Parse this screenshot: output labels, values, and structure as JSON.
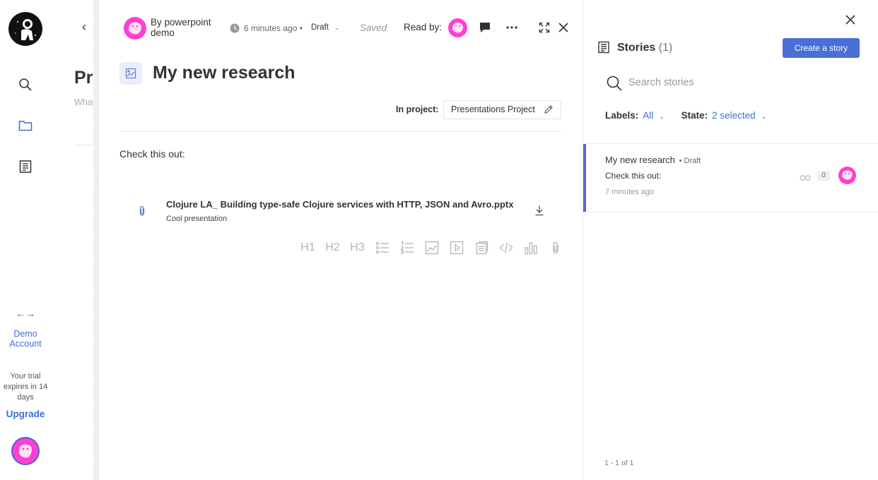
{
  "nav": {
    "items": [
      {
        "name": "search",
        "icon": "search-icon"
      },
      {
        "name": "projects",
        "icon": "folder-icon",
        "active": true
      },
      {
        "name": "stories",
        "icon": "notebook-icon"
      }
    ],
    "swap_glyph": "←→",
    "account_label": "Demo Account",
    "trial_text": "Your trial expires in 14 days",
    "upgrade_label": "Upgrade"
  },
  "background_page": {
    "back_glyph": "‹",
    "title": "Pre",
    "subtitle": "What"
  },
  "editor": {
    "author": "By powerpoint demo",
    "updated": "6 minutes ago •",
    "status": "Draft",
    "saved": "Saved",
    "read_by_label": "Read by:",
    "title": "My new research",
    "project_label": "In project:",
    "project_name": "Presentations Project",
    "body_text": "Check this out:",
    "attachment": {
      "filename": "Clojure LA_ Building type-safe Clojure services with HTTP, JSON and Avro.pptx",
      "description": "Cool presentation"
    },
    "format_bar": [
      "H1",
      "H2",
      "H3"
    ]
  },
  "sidebar": {
    "title": "Stories",
    "count": "(1)",
    "create_label": "Create a story",
    "search_placeholder": "Search stories",
    "labels_label": "Labels:",
    "labels_value": "All",
    "state_label": "State:",
    "state_value": "2 selected",
    "stories": [
      {
        "title": "My new research",
        "status": "• Draft",
        "body": "Check this out:",
        "time": "7 minutes ago",
        "links": "0"
      }
    ],
    "pagination": "1 - 1 of 1"
  },
  "colors": {
    "accent": "#4a6fd6",
    "link": "#3b6fd9",
    "avatar": "#ff3fd2"
  }
}
